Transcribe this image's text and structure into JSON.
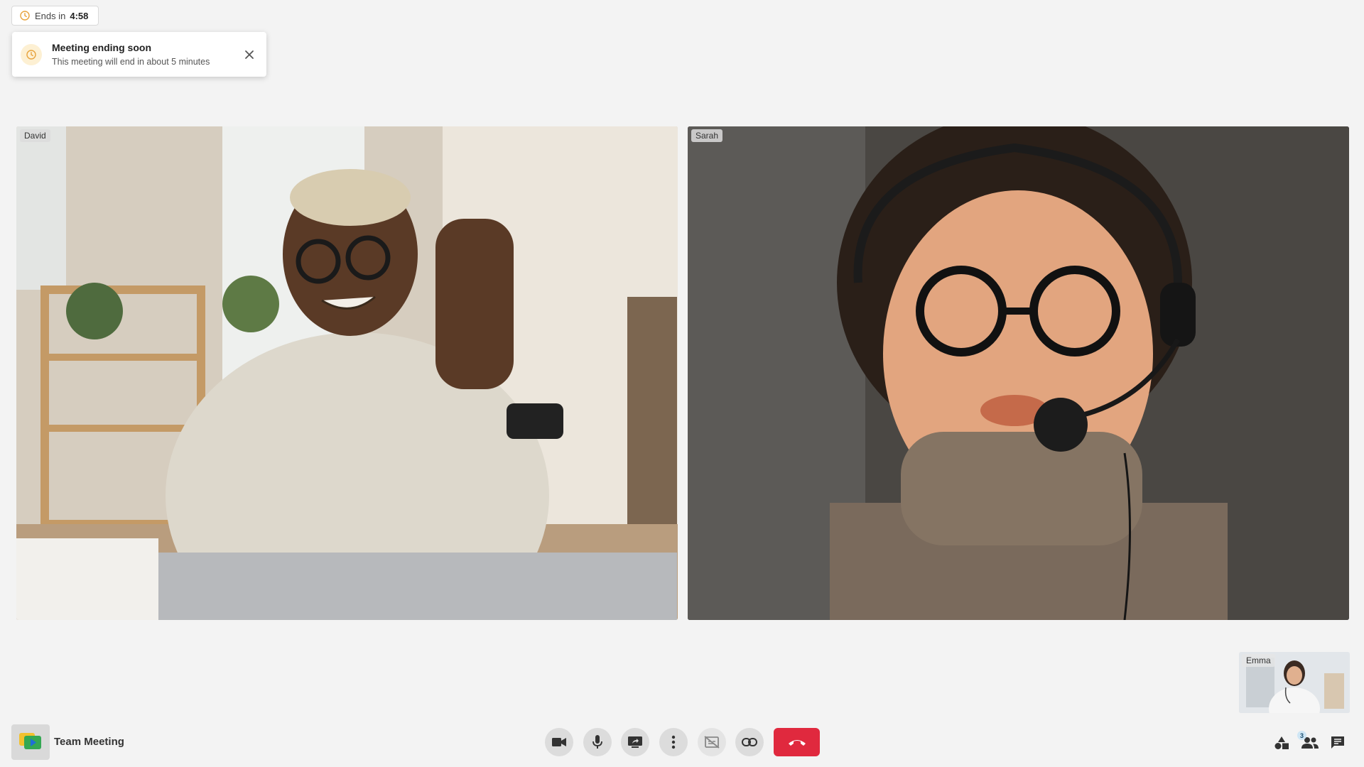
{
  "timer": {
    "prefix": "Ends in",
    "value": "4:58"
  },
  "toast": {
    "title": "Meeting ending soon",
    "body": "This meeting will end in about 5 minutes"
  },
  "participants": [
    {
      "name": "David"
    },
    {
      "name": "Sarah"
    }
  ],
  "self_view": {
    "name": "Emma"
  },
  "meeting": {
    "title": "Team Meeting"
  },
  "controls": [
    {
      "name": "camera-icon"
    },
    {
      "name": "microphone-icon"
    },
    {
      "name": "screen-share-icon"
    },
    {
      "name": "more-options-icon"
    },
    {
      "name": "captions-off-icon"
    },
    {
      "name": "link-icon"
    },
    {
      "name": "hang-up-icon"
    }
  ],
  "right_controls": {
    "participants_count": "3"
  },
  "colors": {
    "hangup": "#e0293e",
    "timer_icon": "#e8a33d",
    "background": "#f3f3f3"
  }
}
